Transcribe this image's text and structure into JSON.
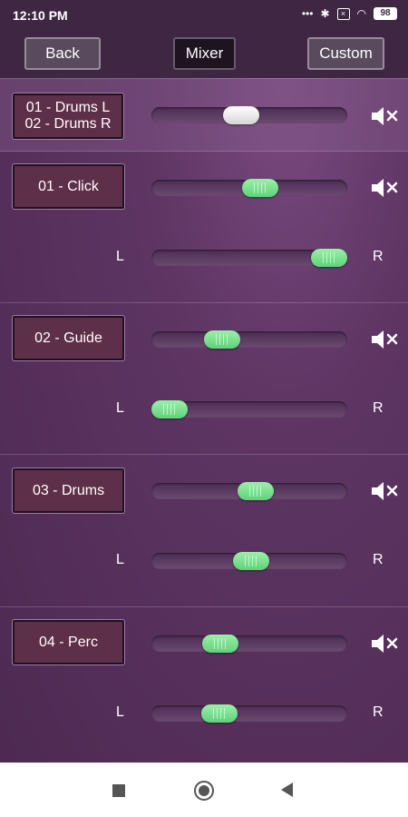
{
  "status_bar": {
    "time": "12:10 PM",
    "dots": "•••",
    "bluetooth": "✱",
    "wifi": "◠",
    "battery": "98"
  },
  "toolbar": {
    "back_label": "Back",
    "mixer_label": "Mixer",
    "custom_label": "Custom"
  },
  "master": {
    "label_line1": "01 - Drums L",
    "label_line2": "02 - Drums R",
    "volume": 0.45,
    "mute_icon": "speaker-muted-icon"
  },
  "channels": [
    {
      "label": "01 - Click",
      "volume": 0.57,
      "pan": 1.0
    },
    {
      "label": "02 - Guide",
      "volume": 0.33,
      "pan": 0.0
    },
    {
      "label": "03 - Drums",
      "volume": 0.54,
      "pan": 0.51
    },
    {
      "label": "04 - Perc",
      "volume": 0.32,
      "pan": 0.31
    }
  ],
  "pan_left_label": "L",
  "pan_right_label": "R",
  "colors": {
    "accent_green": "#6fe08a",
    "background": "#5e3563",
    "toolbar": "#3f2744"
  }
}
